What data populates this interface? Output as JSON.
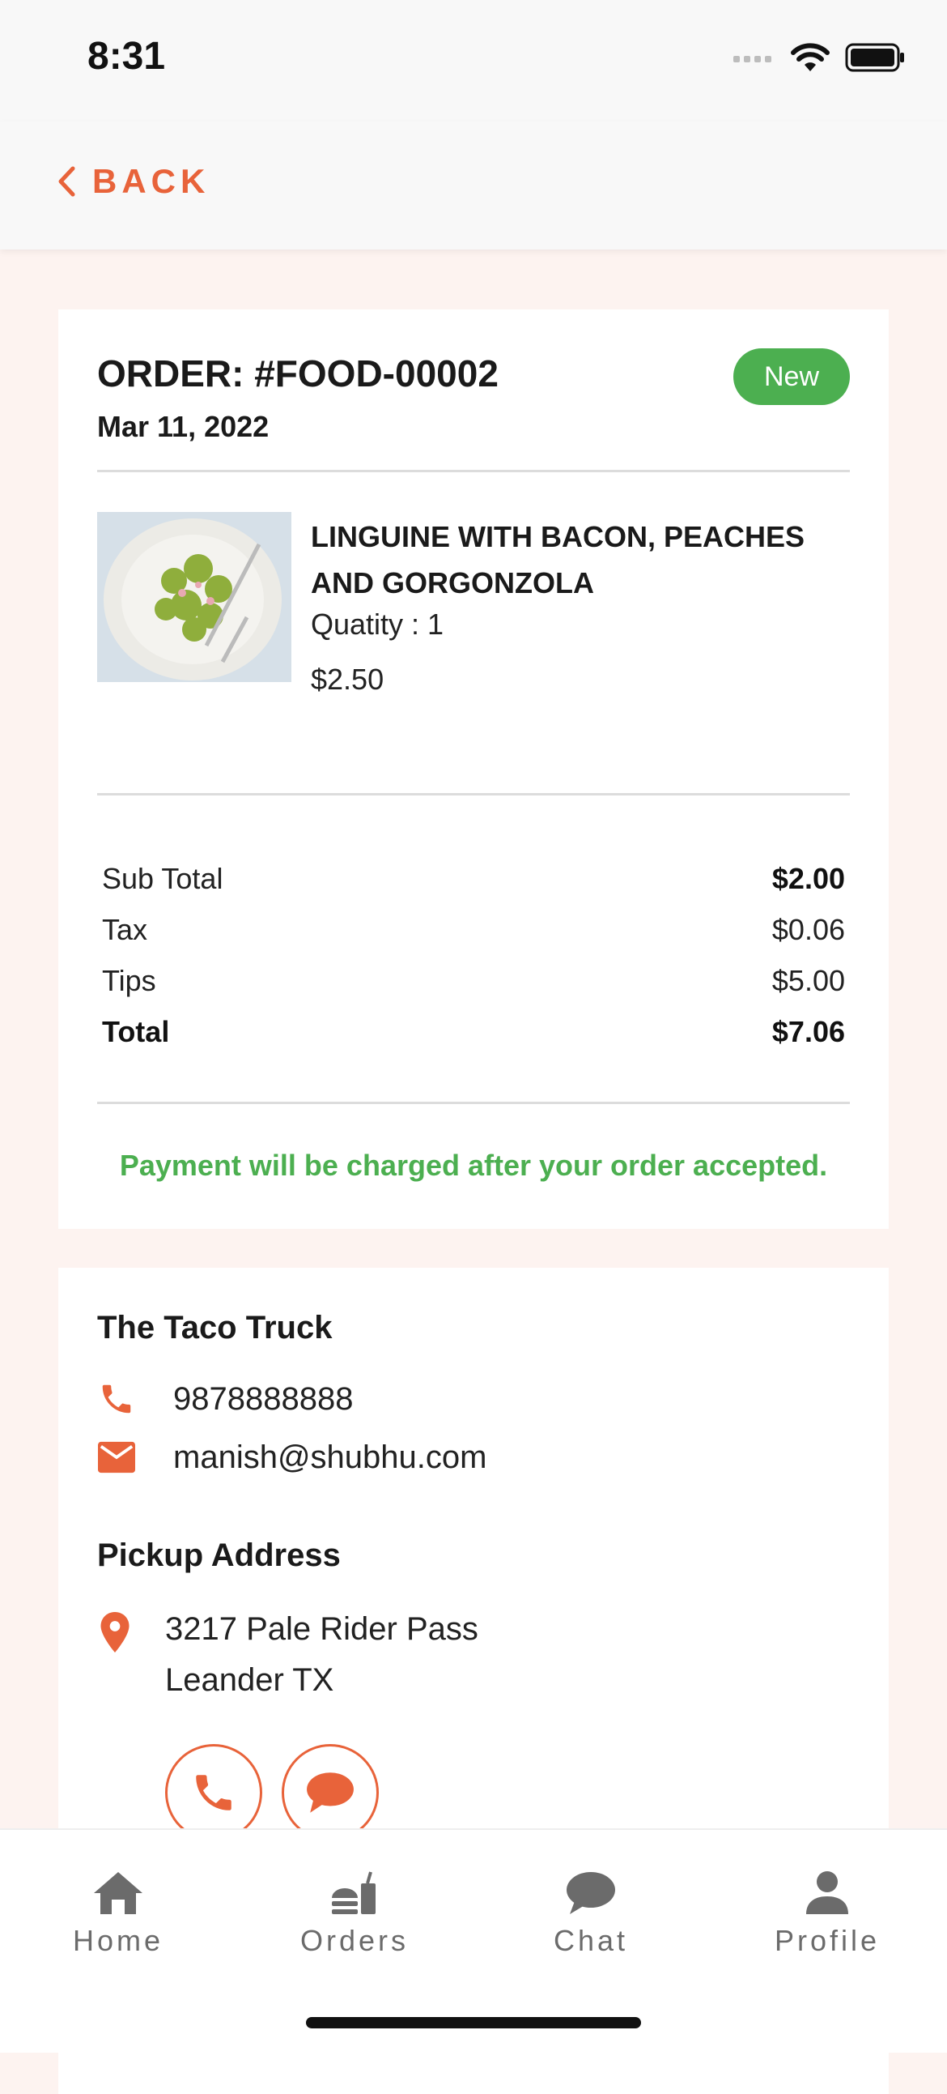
{
  "status_bar": {
    "time": "8:31"
  },
  "header": {
    "back_label": "BACK"
  },
  "order": {
    "title": "ORDER: #FOOD-00002",
    "date": "Mar 11, 2022",
    "status": "New",
    "status_color": "#4caf50",
    "item": {
      "name": "LINGUINE WITH BACON, PEACHES AND GORGONZOLA",
      "quantity": "Quatity : 1",
      "price": "$2.50"
    },
    "summary": {
      "subtotal_label": "Sub Total",
      "subtotal_value": "$2.00",
      "tax_label": "Tax",
      "tax_value": "$0.06",
      "tips_label": "Tips",
      "tips_value": "$5.00",
      "total_label": "Total",
      "total_value": "$7.06"
    },
    "payment_note": "Payment will be charged after your order accepted."
  },
  "vendor": {
    "name": "The Taco Truck",
    "phone": "9878888888",
    "email": "manish@shubhu.com",
    "pickup_title": "Pickup Address",
    "address_line1": "3217 Pale Rider Pass",
    "address_line2": "Leander TX"
  },
  "tabs": [
    {
      "label": "Home",
      "icon": "home-icon"
    },
    {
      "label": "Orders",
      "icon": "orders-icon"
    },
    {
      "label": "Chat",
      "icon": "chat-icon"
    },
    {
      "label": "Profile",
      "icon": "profile-icon"
    }
  ],
  "colors": {
    "accent": "#e8633a",
    "success": "#4caf50",
    "background": "#fdf3f0"
  }
}
